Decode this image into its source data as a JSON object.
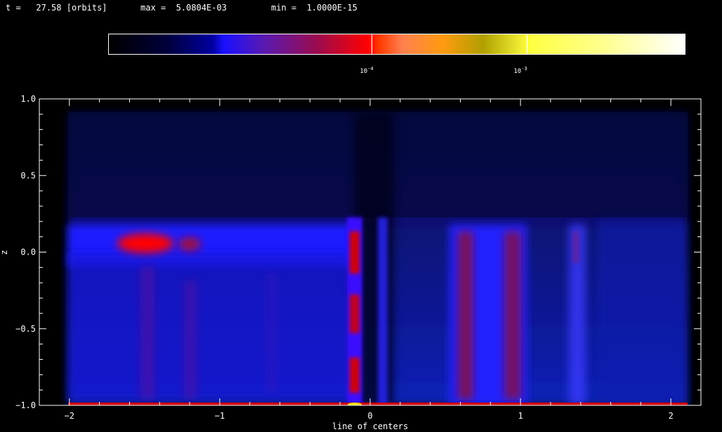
{
  "header": {
    "time_label": "t =",
    "time_value": "27.58",
    "time_unit": "[orbits]",
    "max_label": "max =",
    "max_value": "5.0804E-03",
    "min_label": "min =",
    "min_value": "1.0000E-15"
  },
  "colorbar": {
    "ticks": [
      {
        "base": "10",
        "exp": "-4"
      },
      {
        "base": "10",
        "exp": "-3"
      }
    ]
  },
  "chart_data": {
    "type": "heatmap",
    "title": "",
    "xlabel": "line of centers",
    "ylabel": "z",
    "xlim": [
      -2.2,
      2.2
    ],
    "ylim": [
      -1.0,
      1.0
    ],
    "xticks": [
      -2,
      -1,
      0,
      1,
      2
    ],
    "xtick_labels": [
      "−2",
      "−1",
      "0",
      "1",
      "2"
    ],
    "yticks": [
      -1.0,
      -0.5,
      0.0,
      0.5,
      1.0
    ],
    "ytick_labels": [
      "−1.0",
      "−0.5",
      "0.0",
      "0.5",
      "1.0"
    ],
    "colorscale": "log",
    "value_range": [
      1e-15,
      0.0050804
    ],
    "colorbar_tick_values": [
      0.0001,
      0.001
    ],
    "features": [
      {
        "x": [
          -1.85,
          -1.3
        ],
        "z": [
          -0.02,
          0.13
        ],
        "level": "peak",
        "color": "#ff0000"
      },
      {
        "x": [
          -0.21,
          -0.16
        ],
        "z": [
          -0.98,
          0.2
        ],
        "level": "high",
        "color": "#e00010"
      },
      {
        "x": [
          0.5,
          0.9
        ],
        "z": [
          -0.98,
          0.15
        ],
        "level": "high",
        "color": "#8a1040"
      },
      {
        "x": [
          1.25,
          1.35
        ],
        "z": [
          -0.98,
          0.15
        ],
        "level": "medium",
        "color": "#4020d0"
      },
      {
        "x": [
          -2.0,
          2.0
        ],
        "z": [
          -1.0,
          -0.98
        ],
        "level": "peak",
        "color": "#ff4000"
      }
    ]
  }
}
